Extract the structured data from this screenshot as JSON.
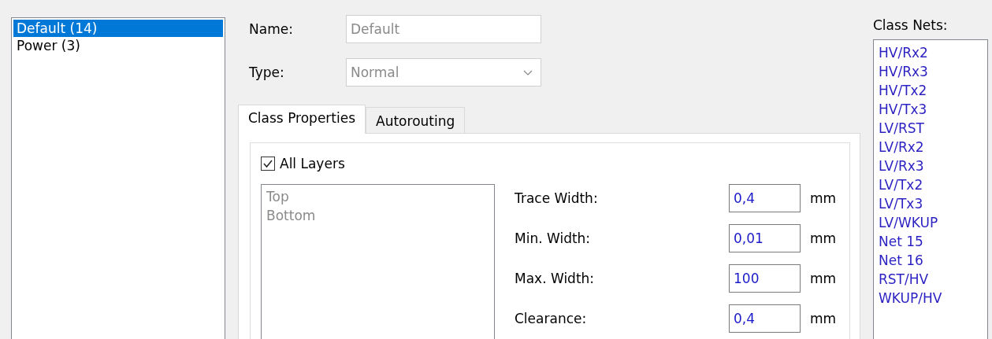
{
  "classes": [
    {
      "label": "Default (14)",
      "selected": true
    },
    {
      "label": "Power (3)",
      "selected": false
    }
  ],
  "name": {
    "label": "Name:",
    "value": "Default",
    "disabled": true
  },
  "type": {
    "label": "Type:",
    "value": "Normal",
    "disabled": true
  },
  "tabs": [
    {
      "label": "Class Properties",
      "selected": true
    },
    {
      "label": "Autorouting",
      "selected": false
    }
  ],
  "all_layers": {
    "label": "All Layers",
    "checked": true
  },
  "layers": [
    {
      "label": "Top",
      "disabled": true
    },
    {
      "label": "Bottom",
      "disabled": true
    }
  ],
  "properties": [
    {
      "label": "Trace Width:",
      "value": "0,4",
      "unit": "mm"
    },
    {
      "label": "Min. Width:",
      "value": "0,01",
      "unit": "mm"
    },
    {
      "label": "Max. Width:",
      "value": "100",
      "unit": "mm"
    },
    {
      "label": "Clearance:",
      "value": "0,4",
      "unit": "mm"
    }
  ],
  "class_nets": {
    "label": "Class Nets:",
    "items": [
      "HV/Rx2",
      "HV/Rx3",
      "HV/Tx2",
      "HV/Tx3",
      "LV/RST",
      "LV/Rx2",
      "LV/Rx3",
      "LV/Tx2",
      "LV/Tx3",
      "LV/WKUP",
      "Net 15",
      "Net 16",
      "RST/HV",
      "WKUP/HV"
    ]
  }
}
